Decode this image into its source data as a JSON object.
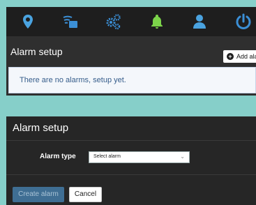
{
  "toolbar": {
    "icons": [
      "location-pin-icon",
      "signal-device-icon",
      "settings-gears-icon",
      "bell-icon",
      "user-icon",
      "power-icon"
    ],
    "colors": {
      "location": "#4aa3e0",
      "signal": "#3b8fd6",
      "gears": "#3b8fd6",
      "bell": "#7cd44a",
      "user": "#4aa3e0",
      "power": "#3b8fd6"
    }
  },
  "alarm_list": {
    "title": "Alarm setup",
    "add_button_label": "Add alarm",
    "empty_message": "There are no alarms, setup yet."
  },
  "alarm_form": {
    "title": "Alarm setup",
    "alarm_type_label": "Alarm type",
    "alarm_type_selected": "Select alarm",
    "create_button_label": "Create alarm",
    "cancel_button_label": "Cancel"
  }
}
